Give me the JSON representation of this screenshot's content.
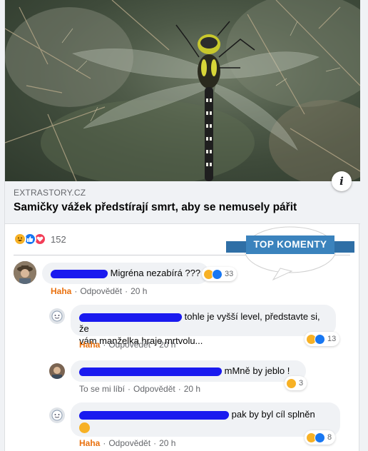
{
  "link": {
    "domain": "EXTRASTORY.CZ",
    "title": "Samičky vážek předstírají smrt, aby se nemusely pářit"
  },
  "reactions": {
    "count": "152",
    "icons": [
      "haha-icon",
      "like-icon",
      "love-icon"
    ]
  },
  "badge": {
    "label": "TOP KOMENTY"
  },
  "comments": [
    {
      "text": "Migréna nezabírá ???",
      "reaction_label": "Haha",
      "reply_label": "Odpovědět",
      "time": "20 h",
      "react_count": "33"
    },
    {
      "text_line1": "tohle je vyšší level, představte si, že",
      "text_line2": "vám manželka hraje mrtvolu...",
      "reaction_label": "Haha",
      "reply_label": "Odpovědět",
      "time": "20 h",
      "react_count": "13"
    },
    {
      "text": "mMně by jeblo !",
      "like_label": "To se mi líbí",
      "reply_label": "Odpovědět",
      "time": "20 h",
      "react_count": "3"
    },
    {
      "text": "pak by byl cíl splněn",
      "reaction_label": "Haha",
      "reply_label": "Odpovědět",
      "time": "20 h",
      "react_count": "8"
    }
  ],
  "colors": {
    "accent": "#1877f2",
    "haha": "#e9710f",
    "redaction": "#1a1aef",
    "badge": "#3b83bd"
  }
}
